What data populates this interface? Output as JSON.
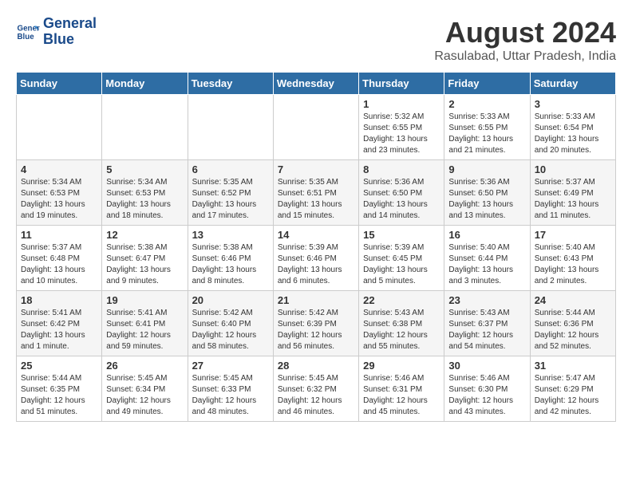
{
  "logo": {
    "line1": "General",
    "line2": "Blue"
  },
  "title": "August 2024",
  "location": "Rasulabad, Uttar Pradesh, India",
  "weekdays": [
    "Sunday",
    "Monday",
    "Tuesday",
    "Wednesday",
    "Thursday",
    "Friday",
    "Saturday"
  ],
  "weeks": [
    [
      {
        "day": "",
        "info": ""
      },
      {
        "day": "",
        "info": ""
      },
      {
        "day": "",
        "info": ""
      },
      {
        "day": "",
        "info": ""
      },
      {
        "day": "1",
        "info": "Sunrise: 5:32 AM\nSunset: 6:55 PM\nDaylight: 13 hours\nand 23 minutes."
      },
      {
        "day": "2",
        "info": "Sunrise: 5:33 AM\nSunset: 6:55 PM\nDaylight: 13 hours\nand 21 minutes."
      },
      {
        "day": "3",
        "info": "Sunrise: 5:33 AM\nSunset: 6:54 PM\nDaylight: 13 hours\nand 20 minutes."
      }
    ],
    [
      {
        "day": "4",
        "info": "Sunrise: 5:34 AM\nSunset: 6:53 PM\nDaylight: 13 hours\nand 19 minutes."
      },
      {
        "day": "5",
        "info": "Sunrise: 5:34 AM\nSunset: 6:53 PM\nDaylight: 13 hours\nand 18 minutes."
      },
      {
        "day": "6",
        "info": "Sunrise: 5:35 AM\nSunset: 6:52 PM\nDaylight: 13 hours\nand 17 minutes."
      },
      {
        "day": "7",
        "info": "Sunrise: 5:35 AM\nSunset: 6:51 PM\nDaylight: 13 hours\nand 15 minutes."
      },
      {
        "day": "8",
        "info": "Sunrise: 5:36 AM\nSunset: 6:50 PM\nDaylight: 13 hours\nand 14 minutes."
      },
      {
        "day": "9",
        "info": "Sunrise: 5:36 AM\nSunset: 6:50 PM\nDaylight: 13 hours\nand 13 minutes."
      },
      {
        "day": "10",
        "info": "Sunrise: 5:37 AM\nSunset: 6:49 PM\nDaylight: 13 hours\nand 11 minutes."
      }
    ],
    [
      {
        "day": "11",
        "info": "Sunrise: 5:37 AM\nSunset: 6:48 PM\nDaylight: 13 hours\nand 10 minutes."
      },
      {
        "day": "12",
        "info": "Sunrise: 5:38 AM\nSunset: 6:47 PM\nDaylight: 13 hours\nand 9 minutes."
      },
      {
        "day": "13",
        "info": "Sunrise: 5:38 AM\nSunset: 6:46 PM\nDaylight: 13 hours\nand 8 minutes."
      },
      {
        "day": "14",
        "info": "Sunrise: 5:39 AM\nSunset: 6:46 PM\nDaylight: 13 hours\nand 6 minutes."
      },
      {
        "day": "15",
        "info": "Sunrise: 5:39 AM\nSunset: 6:45 PM\nDaylight: 13 hours\nand 5 minutes."
      },
      {
        "day": "16",
        "info": "Sunrise: 5:40 AM\nSunset: 6:44 PM\nDaylight: 13 hours\nand 3 minutes."
      },
      {
        "day": "17",
        "info": "Sunrise: 5:40 AM\nSunset: 6:43 PM\nDaylight: 13 hours\nand 2 minutes."
      }
    ],
    [
      {
        "day": "18",
        "info": "Sunrise: 5:41 AM\nSunset: 6:42 PM\nDaylight: 13 hours\nand 1 minute."
      },
      {
        "day": "19",
        "info": "Sunrise: 5:41 AM\nSunset: 6:41 PM\nDaylight: 12 hours\nand 59 minutes."
      },
      {
        "day": "20",
        "info": "Sunrise: 5:42 AM\nSunset: 6:40 PM\nDaylight: 12 hours\nand 58 minutes."
      },
      {
        "day": "21",
        "info": "Sunrise: 5:42 AM\nSunset: 6:39 PM\nDaylight: 12 hours\nand 56 minutes."
      },
      {
        "day": "22",
        "info": "Sunrise: 5:43 AM\nSunset: 6:38 PM\nDaylight: 12 hours\nand 55 minutes."
      },
      {
        "day": "23",
        "info": "Sunrise: 5:43 AM\nSunset: 6:37 PM\nDaylight: 12 hours\nand 54 minutes."
      },
      {
        "day": "24",
        "info": "Sunrise: 5:44 AM\nSunset: 6:36 PM\nDaylight: 12 hours\nand 52 minutes."
      }
    ],
    [
      {
        "day": "25",
        "info": "Sunrise: 5:44 AM\nSunset: 6:35 PM\nDaylight: 12 hours\nand 51 minutes."
      },
      {
        "day": "26",
        "info": "Sunrise: 5:45 AM\nSunset: 6:34 PM\nDaylight: 12 hours\nand 49 minutes."
      },
      {
        "day": "27",
        "info": "Sunrise: 5:45 AM\nSunset: 6:33 PM\nDaylight: 12 hours\nand 48 minutes."
      },
      {
        "day": "28",
        "info": "Sunrise: 5:45 AM\nSunset: 6:32 PM\nDaylight: 12 hours\nand 46 minutes."
      },
      {
        "day": "29",
        "info": "Sunrise: 5:46 AM\nSunset: 6:31 PM\nDaylight: 12 hours\nand 45 minutes."
      },
      {
        "day": "30",
        "info": "Sunrise: 5:46 AM\nSunset: 6:30 PM\nDaylight: 12 hours\nand 43 minutes."
      },
      {
        "day": "31",
        "info": "Sunrise: 5:47 AM\nSunset: 6:29 PM\nDaylight: 12 hours\nand 42 minutes."
      }
    ]
  ]
}
